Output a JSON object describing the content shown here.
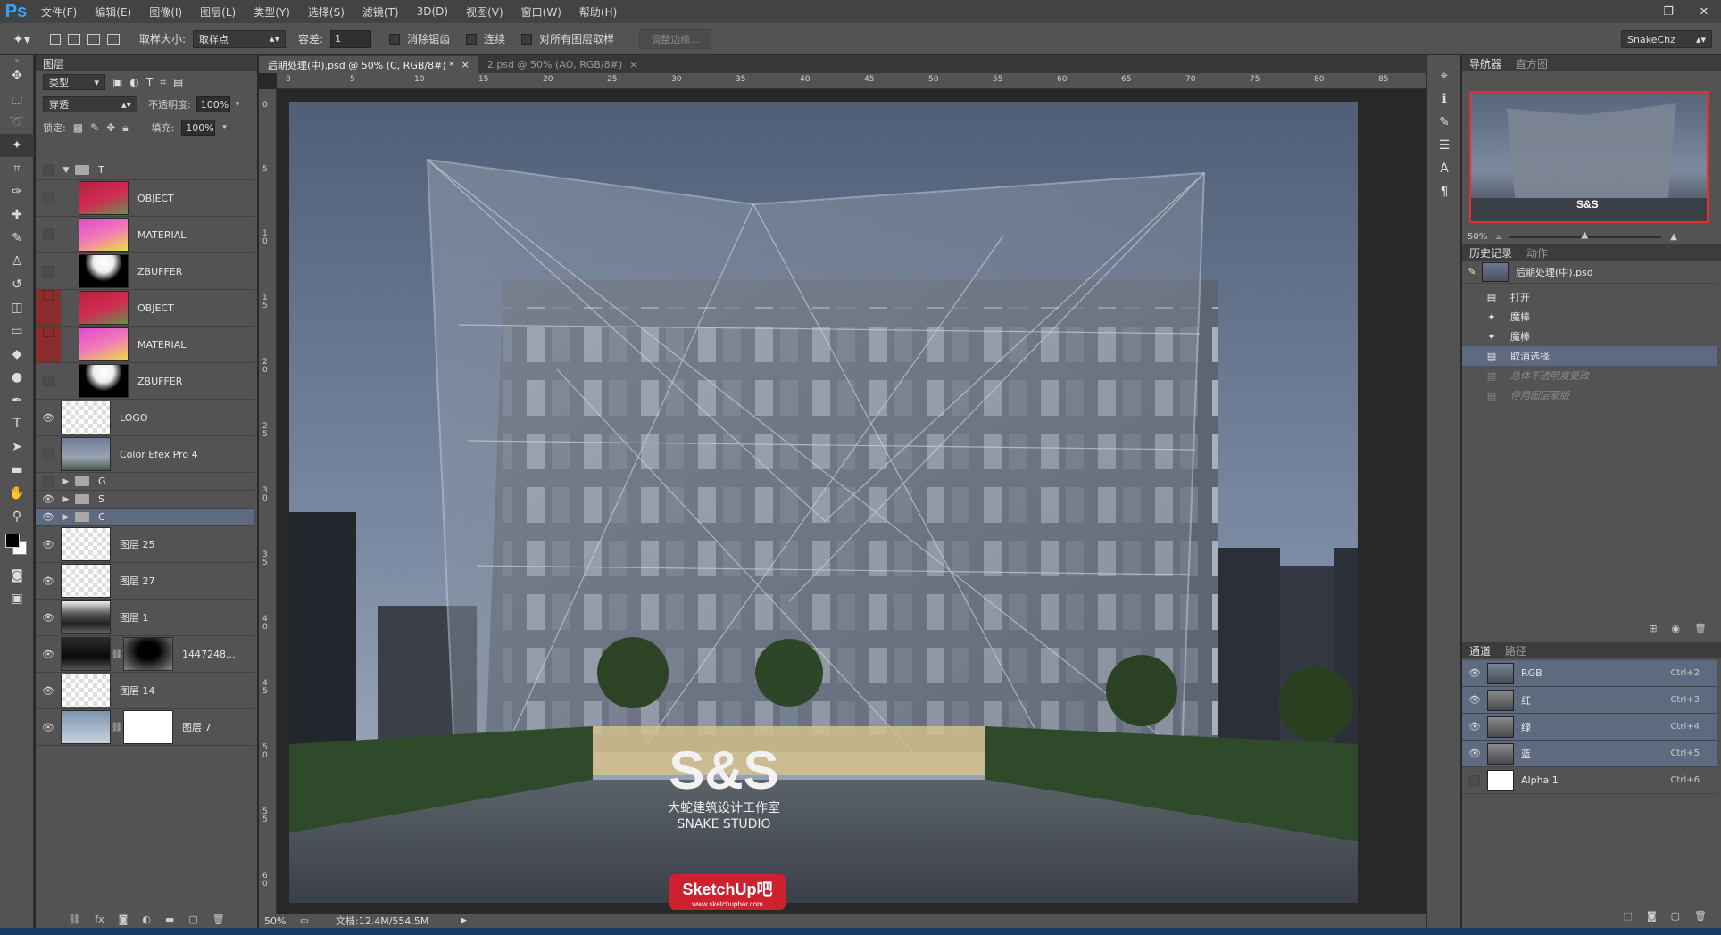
{
  "app": {
    "logo": "Ps",
    "menu": [
      "文件(F)",
      "编辑(E)",
      "图像(I)",
      "图层(L)",
      "类型(Y)",
      "选择(S)",
      "滤镜(T)",
      "3D(D)",
      "视图(V)",
      "窗口(W)",
      "帮助(H)"
    ],
    "win": [
      "—",
      "❐",
      "✕"
    ]
  },
  "options": {
    "sample_size_label": "取样大小:",
    "sample_size_value": "取样点",
    "tolerance_label": "容差:",
    "tolerance_value": "1",
    "antialias_label": "消除锯齿",
    "contiguous_label": "连续",
    "sample_all_label": "对所有图层取样",
    "refine_edge_label": "调整边缘...",
    "workspace": "SnakeChz"
  },
  "layers_panel": {
    "tab": "图层",
    "filter_kind": "类型",
    "blend_mode": "穿透",
    "opacity_label": "不透明度:",
    "opacity_value": "100%",
    "lock_label": "锁定:",
    "fill_label": "填充:",
    "fill_value": "100%",
    "rows": [
      {
        "name": "T"
      },
      {
        "name": "OBJECT"
      },
      {
        "name": "MATERIAL"
      },
      {
        "name": "ZBUFFER"
      },
      {
        "name": "OBJECT"
      },
      {
        "name": "MATERIAL"
      },
      {
        "name": "ZBUFFER"
      },
      {
        "name": "LOGO"
      },
      {
        "name": "Color Efex Pro 4"
      },
      {
        "name": "G"
      },
      {
        "name": "S"
      },
      {
        "name": "C"
      },
      {
        "name": "图层 25"
      },
      {
        "name": "图层 27"
      },
      {
        "name": "图层 1"
      },
      {
        "name": "1447248..."
      },
      {
        "name": "图层 14"
      },
      {
        "name": "图层 7"
      }
    ]
  },
  "doc": {
    "tabs": [
      {
        "title": "后期处理(中).psd @ 50% (C, RGB/8#) *",
        "close": "×"
      },
      {
        "title": "2.psd @ 50% (AO, RGB/8#)",
        "close": "×"
      }
    ],
    "hruler": [
      "0",
      "5",
      "10",
      "15",
      "20",
      "25",
      "30",
      "35",
      "40",
      "45",
      "50",
      "55",
      "60",
      "65",
      "70",
      "75",
      "80",
      "85"
    ],
    "vruler": [
      "0",
      "5",
      "1 0",
      "1 5",
      "2 0",
      "2 5",
      "3 0",
      "3 5",
      "4 0",
      "4 5",
      "5 0",
      "5 5",
      "6 0"
    ],
    "status_zoom": "50%",
    "status_doc": "文档:12.4M/554.5M",
    "logo_main": "S&S",
    "logo_cn": "大蛇建筑设计工作室",
    "logo_en": "SNAKE STUDIO",
    "watermark": "SketchUp吧",
    "watermark_url": "www.sketchupbar.com"
  },
  "navigator": {
    "tabs": [
      "导航器",
      "直方图"
    ],
    "zoom": "50%",
    "logo": "S&S"
  },
  "history": {
    "tabs": [
      "历史记录",
      "动作"
    ],
    "snapshot": "后期处理(中).psd",
    "items": [
      "打开",
      "魔棒",
      "魔棒",
      "取消选择",
      "总体不透明度更改",
      "停用图层蒙版"
    ]
  },
  "channels": {
    "tabs": [
      "通道",
      "路径"
    ],
    "rows": [
      {
        "name": "RGB",
        "key": "Ctrl+2"
      },
      {
        "name": "红",
        "key": "Ctrl+3"
      },
      {
        "name": "绿",
        "key": "Ctrl+4"
      },
      {
        "name": "蓝",
        "key": "Ctrl+5"
      },
      {
        "name": "Alpha 1",
        "key": "Ctrl+6"
      }
    ]
  },
  "colors": {
    "panel": "#535353",
    "dark": "#282828",
    "selected": "#5e6a7f",
    "accent": "#31a8ff"
  }
}
